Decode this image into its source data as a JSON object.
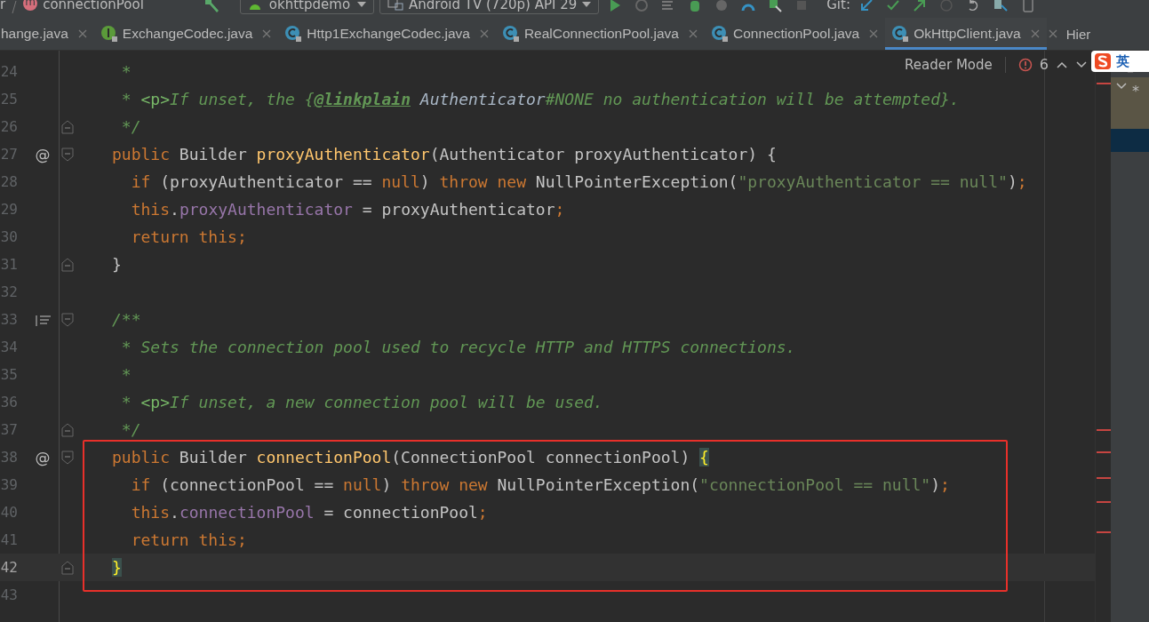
{
  "toolbar": {
    "breadcrumb": [
      "r",
      "connectionPool"
    ],
    "method_badge": "m",
    "run_config": "okhttpdemo",
    "device": "Android TV (720p) API 29",
    "git_label": "Git:"
  },
  "tabs": [
    {
      "label": "hange.java",
      "selected": false
    },
    {
      "label": "ExchangeCodec.java",
      "kind": "interface",
      "selected": false
    },
    {
      "label": "Http1ExchangeCodec.java",
      "kind": "class",
      "selected": false
    },
    {
      "label": "RealConnectionPool.java",
      "kind": "class",
      "selected": false
    },
    {
      "label": "ConnectionPool.java",
      "kind": "class",
      "selected": false
    },
    {
      "label": "OkHttpClient.java",
      "kind": "class",
      "selected": true
    }
  ],
  "side_panel": {
    "title": "Hier",
    "marker": "*"
  },
  "ime": {
    "label": "英"
  },
  "inspection": {
    "reader_mode": "Reader Mode",
    "errors": "6"
  },
  "lines": [
    {
      "number": "24",
      "current": false,
      "tokens": [
        {
          "kind": "comment",
          "text": " *"
        }
      ]
    },
    {
      "number": "25",
      "current": false,
      "tokens": [
        {
          "kind": "comment",
          "text": " * "
        },
        {
          "kind": "doctag",
          "text": "<p>"
        },
        {
          "kind": "comment",
          "text": "If unset, the {"
        },
        {
          "kind": "link",
          "text": "@linkplain"
        },
        {
          "kind": "docref",
          "text": " Authenticator"
        },
        {
          "kind": "comment",
          "text": "#NONE no authentication will be attempted}."
        }
      ]
    },
    {
      "number": "26",
      "current": false,
      "fold_end": true,
      "tokens": [
        {
          "kind": "comment",
          "text": " */"
        }
      ]
    },
    {
      "number": "27",
      "current": false,
      "marker": "@",
      "fold_start": true,
      "tokens": [
        {
          "kind": "keyword",
          "text": "public "
        },
        {
          "kind": "plain",
          "text": "Builder "
        },
        {
          "kind": "method",
          "text": "proxyAuthenticator"
        },
        {
          "kind": "plain",
          "text": "(Authenticator proxyAuthenticator) {"
        }
      ]
    },
    {
      "number": "28",
      "current": false,
      "tokens": [
        {
          "kind": "keyword",
          "text": "  if "
        },
        {
          "kind": "plain",
          "text": "(proxyAuthenticator == "
        },
        {
          "kind": "keyword",
          "text": "null"
        },
        {
          "kind": "plain",
          "text": ") "
        },
        {
          "kind": "keyword",
          "text": "throw new "
        },
        {
          "kind": "plain",
          "text": "NullPointerException("
        },
        {
          "kind": "string",
          "text": "\"proxyAuthenticator == null\""
        },
        {
          "kind": "plain",
          "text": ")"
        },
        {
          "kind": "keyword",
          "text": ";"
        }
      ]
    },
    {
      "number": "29",
      "current": false,
      "tokens": [
        {
          "kind": "keyword",
          "text": "  this"
        },
        {
          "kind": "plain",
          "text": "."
        },
        {
          "kind": "field",
          "text": "proxyAuthenticator"
        },
        {
          "kind": "plain",
          "text": " = proxyAuthenticator"
        },
        {
          "kind": "keyword",
          "text": ";"
        }
      ]
    },
    {
      "number": "30",
      "current": false,
      "tokens": [
        {
          "kind": "keyword",
          "text": "  return this;"
        }
      ]
    },
    {
      "number": "31",
      "current": false,
      "fold_end": true,
      "tokens": [
        {
          "kind": "plain",
          "text": "}"
        }
      ]
    },
    {
      "number": "32",
      "current": false
    },
    {
      "number": "33",
      "current": false,
      "doc_toggle": true,
      "fold_start": true,
      "tokens": [
        {
          "kind": "comment",
          "text": "/**"
        }
      ]
    },
    {
      "number": "34",
      "current": false,
      "tokens": [
        {
          "kind": "comment",
          "text": " * Sets the connection pool used to recycle HTTP and HTTPS connections."
        }
      ]
    },
    {
      "number": "35",
      "current": false,
      "tokens": [
        {
          "kind": "comment",
          "text": " *"
        }
      ]
    },
    {
      "number": "36",
      "current": false,
      "tokens": [
        {
          "kind": "comment",
          "text": " * "
        },
        {
          "kind": "doctag",
          "text": "<p>"
        },
        {
          "kind": "comment",
          "text": "If unset, a new connection pool will be used."
        }
      ]
    },
    {
      "number": "37",
      "current": false,
      "fold_end": true,
      "tokens": [
        {
          "kind": "comment",
          "text": " */"
        }
      ]
    },
    {
      "number": "38",
      "current": false,
      "marker": "@",
      "fold_start": true,
      "tokens": [
        {
          "kind": "keyword",
          "text": "public "
        },
        {
          "kind": "plain",
          "text": "Builder "
        },
        {
          "kind": "method",
          "text": "connectionPool"
        },
        {
          "kind": "plain",
          "text": "(ConnectionPool connectionPool) "
        },
        {
          "kind": "brace",
          "text": "{"
        }
      ]
    },
    {
      "number": "39",
      "current": false,
      "tokens": [
        {
          "kind": "keyword",
          "text": "  if "
        },
        {
          "kind": "plain",
          "text": "(connectionPool == "
        },
        {
          "kind": "keyword",
          "text": "null"
        },
        {
          "kind": "plain",
          "text": ") "
        },
        {
          "kind": "keyword",
          "text": "throw new "
        },
        {
          "kind": "plain",
          "text": "NullPointerException("
        },
        {
          "kind": "string",
          "text": "\"connectionPool == null\""
        },
        {
          "kind": "plain",
          "text": ")"
        },
        {
          "kind": "keyword",
          "text": ";"
        }
      ]
    },
    {
      "number": "40",
      "current": false,
      "tokens": [
        {
          "kind": "keyword",
          "text": "  this"
        },
        {
          "kind": "plain",
          "text": "."
        },
        {
          "kind": "field",
          "text": "connectionPool"
        },
        {
          "kind": "plain",
          "text": " = connectionPool"
        },
        {
          "kind": "keyword",
          "text": ";"
        }
      ]
    },
    {
      "number": "41",
      "current": false,
      "tokens": [
        {
          "kind": "keyword",
          "text": "  return this;"
        }
      ]
    },
    {
      "number": "42",
      "current": true,
      "fold_end": true,
      "tokens": [
        {
          "kind": "brace",
          "text": "}"
        }
      ]
    },
    {
      "number": "43",
      "current": false
    }
  ]
}
